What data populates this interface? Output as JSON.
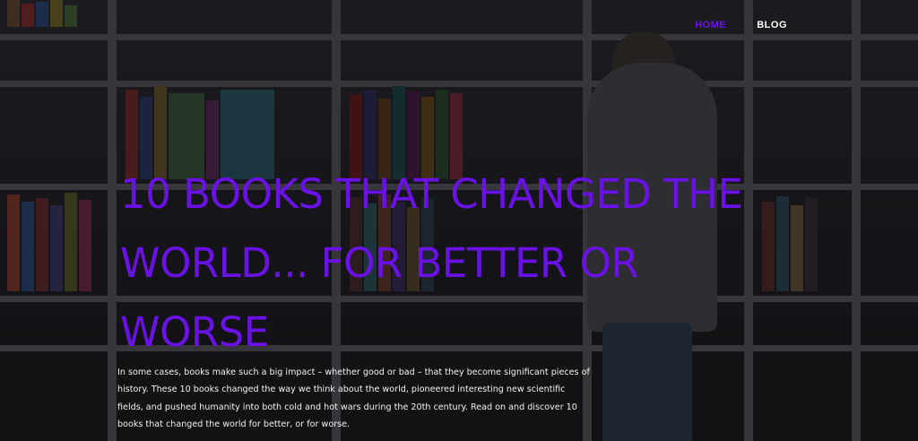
{
  "nav": {
    "items": [
      {
        "label": "HOME",
        "active": true
      },
      {
        "label": "BLOG",
        "active": false
      }
    ],
    "active_color": "#6a12e6"
  },
  "hero": {
    "title": "10 BOOKS THAT CHANGED THE WORLD... FOR BETTER OR WORSE",
    "intro": "In some cases, books make such a big impact – whether good or bad – that they become significant pieces of history. These 10 books changed the way we think about the world, pioneered interesting new scientific fields, and pushed humanity into both cold and hot wars during the 20th century. Read on and discover 10 books that changed the world for better, or for worse.",
    "title_color": "#6a12e6"
  },
  "background": {
    "image": "library-bookshelves-woman-reading"
  }
}
